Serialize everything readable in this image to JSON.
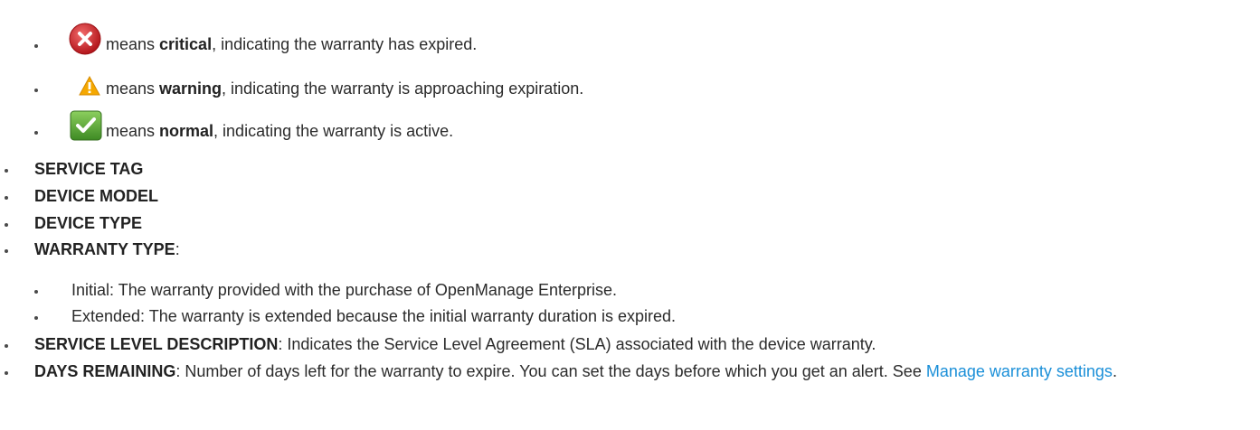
{
  "status_icons": [
    {
      "icon": "critical-icon",
      "color": "#d9262c",
      "prefix": "means ",
      "term": "critical",
      "suffix": ", indicating the warranty has expired."
    },
    {
      "icon": "warning-icon",
      "color": "#f5a800",
      "prefix": "means ",
      "term": "warning",
      "suffix": ", indicating the warranty is approaching expiration."
    },
    {
      "icon": "normal-icon",
      "color": "#4a9a2e",
      "prefix": "means ",
      "term": "normal",
      "suffix": ", indicating the warranty is active."
    }
  ],
  "columns": {
    "service_tag": "SERVICE TAG",
    "device_model": "DEVICE MODEL",
    "device_type": "DEVICE TYPE",
    "warranty_type": "WARRANTY TYPE",
    "warranty_type_suffix": ":"
  },
  "warranty_types": [
    "Initial: The warranty provided with the purchase of OpenManage Enterprise.",
    "Extended: The warranty is extended because the initial warranty duration is expired."
  ],
  "service_level": {
    "term": "SERVICE LEVEL DESCRIPTION",
    "text": ": Indicates the Service Level Agreement (SLA) associated with the device warranty."
  },
  "days_remaining": {
    "term": "DAYS REMAINING",
    "text": ": Number of days left for the warranty to expire. You can set the days before which you get an alert. See ",
    "link_text": "Manage warranty settings",
    "end": "."
  }
}
